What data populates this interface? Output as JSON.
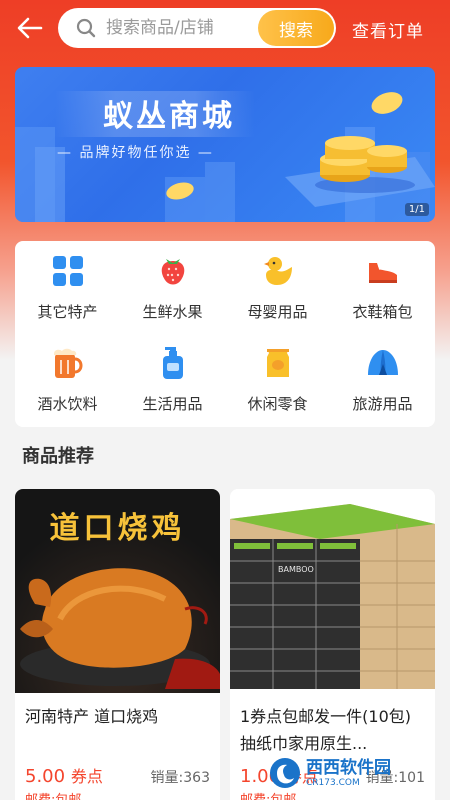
{
  "header": {
    "search_placeholder": "搜索商品/店铺",
    "search_button": "搜索",
    "orders_link": "查看订单"
  },
  "banner": {
    "title": "蚁丛商城",
    "subtitle": "— 品牌好物任你选 —",
    "counter": "1/1"
  },
  "categories": [
    {
      "label": "其它特产",
      "icon": "grid-icon"
    },
    {
      "label": "生鲜水果",
      "icon": "strawberry-icon"
    },
    {
      "label": "母婴用品",
      "icon": "duck-icon"
    },
    {
      "label": "衣鞋箱包",
      "icon": "shoe-icon"
    },
    {
      "label": "酒水饮料",
      "icon": "beer-icon"
    },
    {
      "label": "生活用品",
      "icon": "pump-bottle-icon"
    },
    {
      "label": "休闲零食",
      "icon": "snack-bag-icon"
    },
    {
      "label": "旅游用品",
      "icon": "tent-icon"
    }
  ],
  "section": {
    "title": "商品推荐"
  },
  "products": [
    {
      "image_text": "道口烧鸡",
      "name": "河南特产 道口烧鸡",
      "price": "5.00",
      "price_unit": "券点",
      "sales": "销量:363",
      "shipping": "邮费:包邮"
    },
    {
      "image_text": "BAMBOO",
      "name": "1券点包邮发一件(10包) 抽纸巾家用原生...",
      "price": "1.00",
      "price_unit": "券点",
      "sales": "销量:101",
      "shipping": "邮费:包邮"
    }
  ],
  "watermark": {
    "text": "西西软件园",
    "url_text": "CR173.COM"
  },
  "colors": {
    "accent": "#f4452d",
    "search_button": "#f7a91b",
    "banner": "#2f6fe9"
  }
}
